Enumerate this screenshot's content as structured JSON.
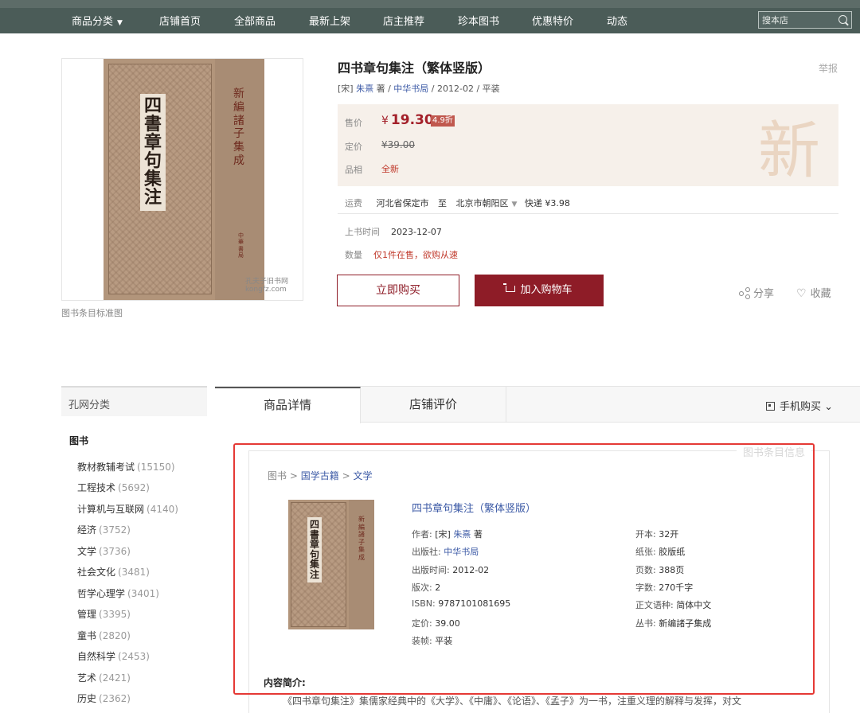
{
  "nav": {
    "items": [
      "商品分类",
      "店铺首页",
      "全部商品",
      "最新上架",
      "店主推荐",
      "珍本图书",
      "优惠特价",
      "动态"
    ],
    "caret": "▼",
    "search_placeholder": "搜本店"
  },
  "cover": {
    "book_title_chars": "四書章句集注",
    "series": "新編諸子集成",
    "publisher": "中華書局",
    "watermark_line1": "孔夫子旧书网",
    "watermark_line2": "kongfz.com",
    "caption": "图书条目标准图"
  },
  "product": {
    "title": "四书章句集注（繁体竖版）",
    "report": "举报",
    "meta_author_prefix": "[宋]",
    "author": "朱熹",
    "author_suffix": "著 /",
    "publisher": "中华书局",
    "meta_rest": "/ 2012-02 / 平装",
    "price_label": "售价",
    "price_currency": "¥",
    "price": "19.30",
    "discount": "4.9折",
    "orig_price_label": "定价",
    "orig_price": "¥39.00",
    "condition_label": "品相",
    "condition": "全新",
    "bg_char": "新",
    "shipping_label": "运费",
    "ship_from": "河北省保定市",
    "ship_to_word": "至",
    "ship_to": "北京市朝阳区",
    "ship_caret": "▼",
    "ship_method": "快递 ¥3.98",
    "listed_label": "上书时间",
    "listed_date": "2023-12-07",
    "qty_label": "数量",
    "qty_value": "仅1件在售，欲购从速",
    "buy_now": "立即购买",
    "add_cart": "加入购物车",
    "share": "分享",
    "favorite": "收藏"
  },
  "sidebar": {
    "heading": "孔网分类",
    "root": "图书",
    "categories": [
      {
        "name": "教材教辅考试",
        "count": "(15150)"
      },
      {
        "name": "工程技术",
        "count": "(5692)"
      },
      {
        "name": "计算机与互联网",
        "count": "(4140)"
      },
      {
        "name": "经济",
        "count": "(3752)"
      },
      {
        "name": "文学",
        "count": "(3736)"
      },
      {
        "name": "社会文化",
        "count": "(3481)"
      },
      {
        "name": "哲学心理学",
        "count": "(3401)"
      },
      {
        "name": "管理",
        "count": "(3395)"
      },
      {
        "name": "童书",
        "count": "(2820)"
      },
      {
        "name": "自然科学",
        "count": "(2453)"
      },
      {
        "name": "艺术",
        "count": "(2421)"
      },
      {
        "name": "历史",
        "count": "(2362)"
      }
    ]
  },
  "tabs": {
    "details": "商品详情",
    "reviews": "店铺评价",
    "mobile_buy": "手机购买",
    "mobile_caret": "⌄"
  },
  "detail": {
    "frame_label": "图书条目信息",
    "breadcrumb": {
      "root": "图书",
      "sep": ">",
      "cat1": "国学古籍",
      "cat2": "文学"
    },
    "title": "四书章句集注（繁体竖版）",
    "left_attrs": {
      "author_label": "作者:",
      "author_prefix": "[宋]",
      "author": "朱熹",
      "author_suffix": "著",
      "publisher_label": "出版社:",
      "publisher": "中华书局",
      "pubdate_label": "出版时间:",
      "pubdate": "2012-02",
      "edition_label": "版次:",
      "edition": "2",
      "isbn_label": "ISBN:",
      "isbn": "9787101081695",
      "price_label": "定价:",
      "price": "39.00",
      "binding_label": "装帧:",
      "binding": "平装"
    },
    "right_attrs": {
      "format_label": "开本:",
      "format": "32开",
      "paper_label": "纸张:",
      "paper": "胶版纸",
      "pages_label": "页数:",
      "pages": "388页",
      "words_label": "字数:",
      "words": "270千字",
      "lang_label": "正文语种:",
      "lang": "简体中文",
      "series_label": "丛书:",
      "series": "新编諸子集成"
    },
    "intro_title": "内容简介:",
    "intro_text": "《四书章句集注》集儒家经典中的《大学》、《中庸》、《论语》、《孟子》为一书，注重义理的解释与发挥，对文"
  },
  "colors": {
    "nav_bg": "#4b5c58",
    "accent": "#8e1c27",
    "price_red": "#a3202a",
    "link_blue": "#3c5aa6",
    "highlight": "#e53935"
  }
}
